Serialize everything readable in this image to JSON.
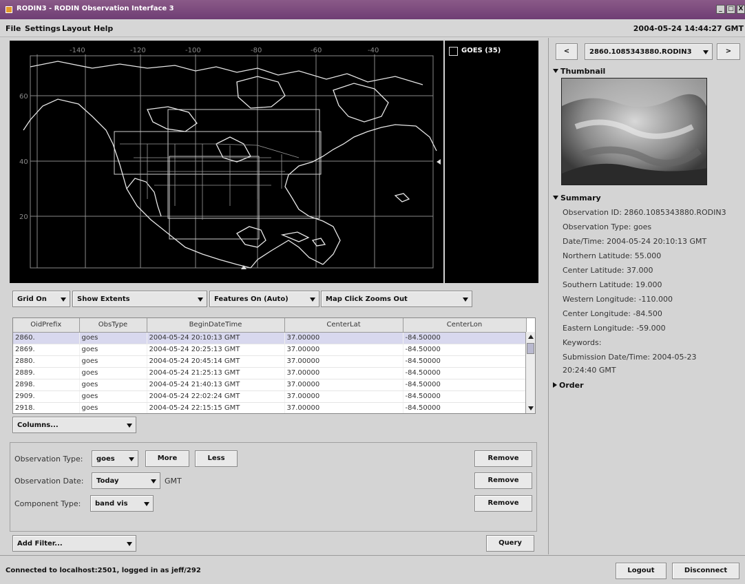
{
  "window": {
    "title": "RODIN3 - RODIN Observation Interface 3",
    "controls": [
      "_",
      "□",
      "X"
    ]
  },
  "menubar": {
    "items": [
      "File",
      "Settings",
      "Layout",
      "Help"
    ],
    "clock": "2004-05-24 14:44:27 GMT"
  },
  "map": {
    "lon_labels": [
      "-140",
      "-120",
      "-100",
      "-80",
      "-60",
      "-40"
    ],
    "lat_labels": [
      "60",
      "40",
      "20"
    ]
  },
  "goes_panel": {
    "label": "GOES (35)",
    "checked": false
  },
  "map_controls": {
    "grid": "Grid On",
    "extents": "Show Extents",
    "features": "Features On (Auto)",
    "click": "Map Click Zooms Out"
  },
  "table": {
    "columns": [
      "OidPrefix",
      "ObsType",
      "BeginDateTime",
      "CenterLat",
      "CenterLon"
    ],
    "rows": [
      [
        "2860.",
        "goes",
        "2004-05-24 20:10:13 GMT",
        "37.00000",
        "-84.50000"
      ],
      [
        "2869.",
        "goes",
        "2004-05-24 20:25:13 GMT",
        "37.00000",
        "-84.50000"
      ],
      [
        "2880.",
        "goes",
        "2004-05-24 20:45:14 GMT",
        "37.00000",
        "-84.50000"
      ],
      [
        "2889.",
        "goes",
        "2004-05-24 21:25:13 GMT",
        "37.00000",
        "-84.50000"
      ],
      [
        "2898.",
        "goes",
        "2004-05-24 21:40:13 GMT",
        "37.00000",
        "-84.50000"
      ],
      [
        "2909.",
        "goes",
        "2004-05-24 22:02:24 GMT",
        "37.00000",
        "-84.50000"
      ],
      [
        "2918.",
        "goes",
        "2004-05-24 22:15:15 GMT",
        "37.00000",
        "-84.50000"
      ]
    ],
    "columns_button": "Columns..."
  },
  "filters": {
    "obs_type_label": "Observation Type:",
    "obs_type_value": "goes",
    "more": "More",
    "less": "Less",
    "obs_date_label": "Observation Date:",
    "obs_date_value": "Today",
    "gmt": "GMT",
    "component_label": "Component Type:",
    "component_value": "band vis",
    "remove": "Remove",
    "add_filter": "Add Filter...",
    "query": "Query"
  },
  "detail": {
    "prev": "<",
    "next": ">",
    "observation_select": "2860.1085343880.RODIN3",
    "thumbnail_header": "Thumbnail",
    "summary_header": "Summary",
    "summary_lines": [
      "Observation ID: 2860.1085343880.RODIN3",
      "Observation Type: goes",
      "Date/Time: 2004-05-24 20:10:13 GMT",
      "Northern Latitude: 55.000",
      "Center Latitude: 37.000",
      "Southern Latitude: 19.000",
      "Western Longitude: -110.000",
      "Center Longitude: -84.500",
      "Eastern Longitude: -59.000",
      "Keywords:",
      "Submission Date/Time: 2004-05-23",
      "20:24:40 GMT"
    ],
    "order_header": "Order"
  },
  "status": {
    "text": "Connected to localhost:2501, logged in as jeff/292",
    "logout": "Logout",
    "disconnect": "Disconnect"
  }
}
